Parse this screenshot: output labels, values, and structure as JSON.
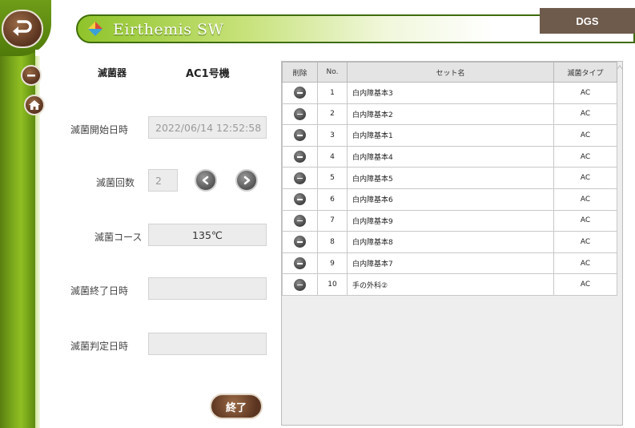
{
  "header": {
    "app_title": "Eirthemis SW",
    "right_badge": "DGS"
  },
  "form": {
    "device_label": "滅菌器",
    "device_value": "AC1号機",
    "start_label": "滅菌開始日時",
    "start_value": "2022/06/14 12:52:58",
    "count_label": "滅菌回数",
    "count_value": "2",
    "course_label": "滅菌コース",
    "course_value": "135℃",
    "end_time_label": "滅菌終了日時",
    "end_time_value": "",
    "judge_label": "滅菌判定日時",
    "judge_value": "",
    "end_button": "終了"
  },
  "table": {
    "headers": [
      "削除",
      "No.",
      "セット名",
      "滅菌タイプ"
    ],
    "rows": [
      {
        "no": "1",
        "name": "白内障基本3",
        "type": "AC"
      },
      {
        "no": "2",
        "name": "白内障基本2",
        "type": "AC"
      },
      {
        "no": "3",
        "name": "白内障基本1",
        "type": "AC"
      },
      {
        "no": "4",
        "name": "白内障基本4",
        "type": "AC"
      },
      {
        "no": "5",
        "name": "白内障基本5",
        "type": "AC"
      },
      {
        "no": "6",
        "name": "白内障基本6",
        "type": "AC"
      },
      {
        "no": "7",
        "name": "白内障基本9",
        "type": "AC"
      },
      {
        "no": "8",
        "name": "白内障基本8",
        "type": "AC"
      },
      {
        "no": "9",
        "name": "白内障基本7",
        "type": "AC"
      },
      {
        "no": "10",
        "name": "手の外科②",
        "type": "AC"
      }
    ]
  },
  "icons": {
    "back": "back-arrow-icon",
    "minus": "minus-icon",
    "home": "home-icon",
    "prev": "chevron-left-icon",
    "next": "chevron-right-icon",
    "delete": "remove-row-icon",
    "logo": "diamond-logo-icon"
  }
}
